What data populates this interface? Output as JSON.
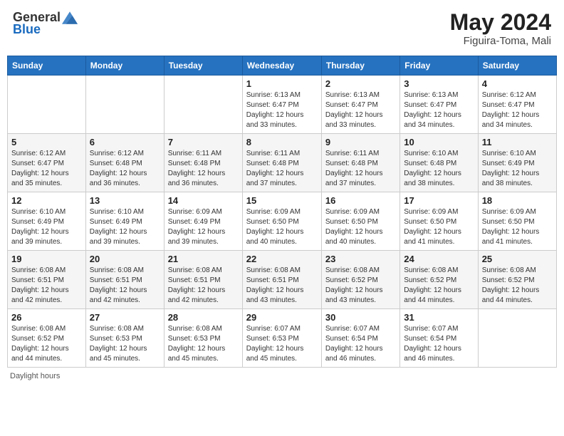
{
  "header": {
    "logo_general": "General",
    "logo_blue": "Blue",
    "month": "May 2024",
    "location": "Figuira-Toma, Mali"
  },
  "days_of_week": [
    "Sunday",
    "Monday",
    "Tuesday",
    "Wednesday",
    "Thursday",
    "Friday",
    "Saturday"
  ],
  "weeks": [
    [
      {
        "day": "",
        "info": ""
      },
      {
        "day": "",
        "info": ""
      },
      {
        "day": "",
        "info": ""
      },
      {
        "day": "1",
        "info": "Sunrise: 6:13 AM\nSunset: 6:47 PM\nDaylight: 12 hours\nand 33 minutes."
      },
      {
        "day": "2",
        "info": "Sunrise: 6:13 AM\nSunset: 6:47 PM\nDaylight: 12 hours\nand 33 minutes."
      },
      {
        "day": "3",
        "info": "Sunrise: 6:13 AM\nSunset: 6:47 PM\nDaylight: 12 hours\nand 34 minutes."
      },
      {
        "day": "4",
        "info": "Sunrise: 6:12 AM\nSunset: 6:47 PM\nDaylight: 12 hours\nand 34 minutes."
      }
    ],
    [
      {
        "day": "5",
        "info": "Sunrise: 6:12 AM\nSunset: 6:47 PM\nDaylight: 12 hours\nand 35 minutes."
      },
      {
        "day": "6",
        "info": "Sunrise: 6:12 AM\nSunset: 6:48 PM\nDaylight: 12 hours\nand 36 minutes."
      },
      {
        "day": "7",
        "info": "Sunrise: 6:11 AM\nSunset: 6:48 PM\nDaylight: 12 hours\nand 36 minutes."
      },
      {
        "day": "8",
        "info": "Sunrise: 6:11 AM\nSunset: 6:48 PM\nDaylight: 12 hours\nand 37 minutes."
      },
      {
        "day": "9",
        "info": "Sunrise: 6:11 AM\nSunset: 6:48 PM\nDaylight: 12 hours\nand 37 minutes."
      },
      {
        "day": "10",
        "info": "Sunrise: 6:10 AM\nSunset: 6:48 PM\nDaylight: 12 hours\nand 38 minutes."
      },
      {
        "day": "11",
        "info": "Sunrise: 6:10 AM\nSunset: 6:49 PM\nDaylight: 12 hours\nand 38 minutes."
      }
    ],
    [
      {
        "day": "12",
        "info": "Sunrise: 6:10 AM\nSunset: 6:49 PM\nDaylight: 12 hours\nand 39 minutes."
      },
      {
        "day": "13",
        "info": "Sunrise: 6:10 AM\nSunset: 6:49 PM\nDaylight: 12 hours\nand 39 minutes."
      },
      {
        "day": "14",
        "info": "Sunrise: 6:09 AM\nSunset: 6:49 PM\nDaylight: 12 hours\nand 39 minutes."
      },
      {
        "day": "15",
        "info": "Sunrise: 6:09 AM\nSunset: 6:50 PM\nDaylight: 12 hours\nand 40 minutes."
      },
      {
        "day": "16",
        "info": "Sunrise: 6:09 AM\nSunset: 6:50 PM\nDaylight: 12 hours\nand 40 minutes."
      },
      {
        "day": "17",
        "info": "Sunrise: 6:09 AM\nSunset: 6:50 PM\nDaylight: 12 hours\nand 41 minutes."
      },
      {
        "day": "18",
        "info": "Sunrise: 6:09 AM\nSunset: 6:50 PM\nDaylight: 12 hours\nand 41 minutes."
      }
    ],
    [
      {
        "day": "19",
        "info": "Sunrise: 6:08 AM\nSunset: 6:51 PM\nDaylight: 12 hours\nand 42 minutes."
      },
      {
        "day": "20",
        "info": "Sunrise: 6:08 AM\nSunset: 6:51 PM\nDaylight: 12 hours\nand 42 minutes."
      },
      {
        "day": "21",
        "info": "Sunrise: 6:08 AM\nSunset: 6:51 PM\nDaylight: 12 hours\nand 42 minutes."
      },
      {
        "day": "22",
        "info": "Sunrise: 6:08 AM\nSunset: 6:51 PM\nDaylight: 12 hours\nand 43 minutes."
      },
      {
        "day": "23",
        "info": "Sunrise: 6:08 AM\nSunset: 6:52 PM\nDaylight: 12 hours\nand 43 minutes."
      },
      {
        "day": "24",
        "info": "Sunrise: 6:08 AM\nSunset: 6:52 PM\nDaylight: 12 hours\nand 44 minutes."
      },
      {
        "day": "25",
        "info": "Sunrise: 6:08 AM\nSunset: 6:52 PM\nDaylight: 12 hours\nand 44 minutes."
      }
    ],
    [
      {
        "day": "26",
        "info": "Sunrise: 6:08 AM\nSunset: 6:52 PM\nDaylight: 12 hours\nand 44 minutes."
      },
      {
        "day": "27",
        "info": "Sunrise: 6:08 AM\nSunset: 6:53 PM\nDaylight: 12 hours\nand 45 minutes."
      },
      {
        "day": "28",
        "info": "Sunrise: 6:08 AM\nSunset: 6:53 PM\nDaylight: 12 hours\nand 45 minutes."
      },
      {
        "day": "29",
        "info": "Sunrise: 6:07 AM\nSunset: 6:53 PM\nDaylight: 12 hours\nand 45 minutes."
      },
      {
        "day": "30",
        "info": "Sunrise: 6:07 AM\nSunset: 6:54 PM\nDaylight: 12 hours\nand 46 minutes."
      },
      {
        "day": "31",
        "info": "Sunrise: 6:07 AM\nSunset: 6:54 PM\nDaylight: 12 hours\nand 46 minutes."
      },
      {
        "day": "",
        "info": ""
      }
    ]
  ],
  "footer": {
    "daylight_hours": "Daylight hours"
  }
}
